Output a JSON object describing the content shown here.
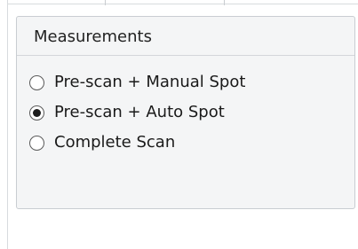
{
  "measurements": {
    "title": "Measurements",
    "options": [
      {
        "label": "Pre-scan + Manual Spot",
        "selected": false
      },
      {
        "label": "Pre-scan + Auto Spot",
        "selected": true
      },
      {
        "label": "Complete Scan",
        "selected": false
      }
    ]
  }
}
